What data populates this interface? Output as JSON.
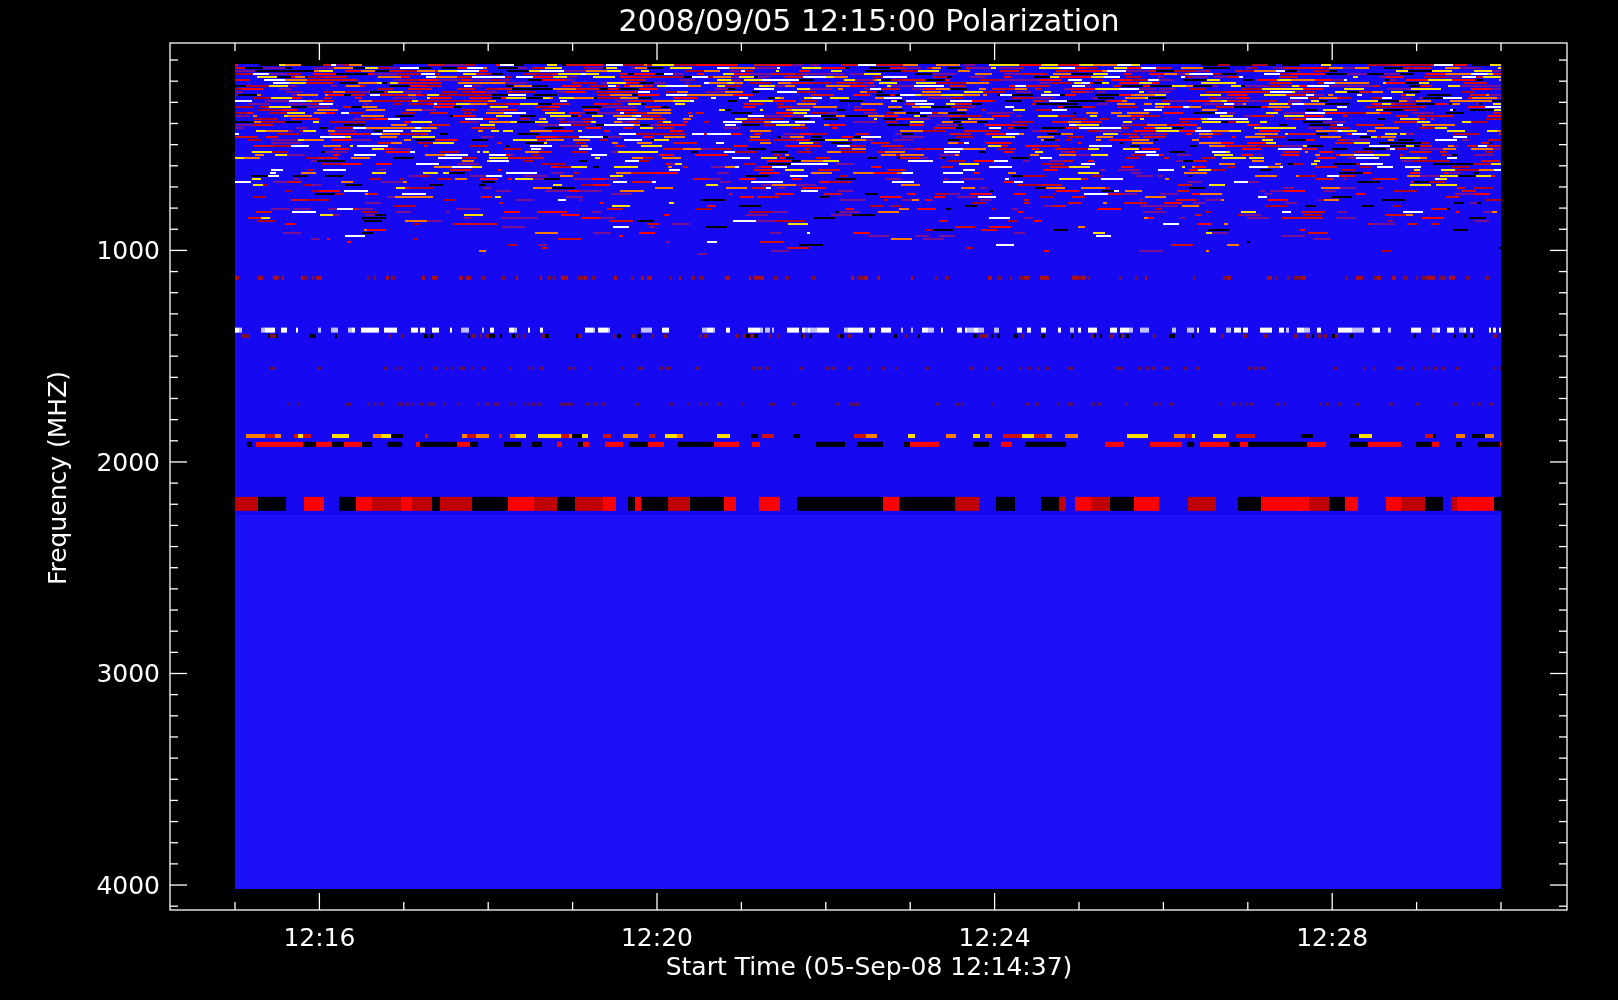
{
  "plot": {
    "title": "2008/09/05 12:15:00 Polarization",
    "ylabel": "Frequency (MHZ)",
    "xlabel": "Start Time (05-Sep-08 12:14:37)",
    "yticks": [
      "1000",
      "2000",
      "3000",
      "4000"
    ],
    "xticks": [
      "12:16",
      "12:20",
      "12:24",
      "12:28"
    ]
  }
}
